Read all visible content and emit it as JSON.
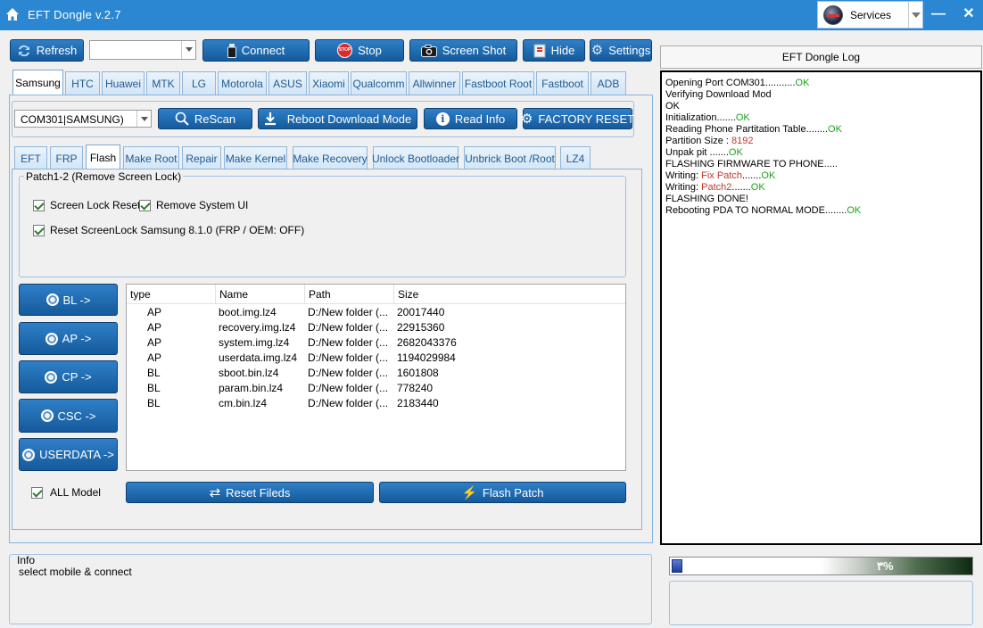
{
  "window": {
    "title": "EFT Dongle  v.2.7",
    "services_label": "Services",
    "minimize": "—",
    "close": "✕"
  },
  "toolbar": {
    "refresh": "Refresh",
    "port_value": "",
    "connect": "Connect",
    "stop": "Stop",
    "stop_badge": "STOP",
    "screenshot": "Screen Shot",
    "hide": "Hide",
    "settings": "Settings"
  },
  "brand_tabs": [
    "Samsung",
    "HTC",
    "Huawei",
    "MTK",
    "LG",
    "Motorola",
    "ASUS",
    "Xiaomi",
    "Qualcomm",
    "Allwinner",
    "Fastboot Root",
    "Fastboot",
    "ADB"
  ],
  "brand_active": "Samsung",
  "device_bar": {
    "port_select": "COM301|SAMSUNG)",
    "rescan": "ReScan",
    "reboot_download": "Reboot  Download Mode",
    "read_info": "Read Info",
    "factory_reset": "FACTORY RESET"
  },
  "func_tabs": [
    "EFT",
    "FRP",
    "Flash",
    "Make Root",
    "Repair",
    "Make Kernel",
    "Make Recovery",
    "Unlock Bootloader",
    "Unbrick Boot /Root",
    "LZ4"
  ],
  "func_active": "Flash",
  "patch_group": {
    "title": "Patch1-2 (Remove Screen Lock)",
    "options": [
      {
        "label": "Screen Lock Reset",
        "checked": true
      },
      {
        "label": "Remove System UI",
        "checked": true
      },
      {
        "label": "Reset ScreenLock Samsung 8.1.0 (FRP / OEM: OFF)",
        "checked": true
      }
    ]
  },
  "side_buttons": [
    "BL ->",
    "AP ->",
    "CP ->",
    "CSC ->",
    "USERDATA ->"
  ],
  "all_model": {
    "label": "ALL Model",
    "checked": true
  },
  "file_table": {
    "columns": [
      "type",
      "Name",
      "Path",
      "Size"
    ],
    "rows": [
      {
        "type": "AP",
        "name": "boot.img.lz4",
        "path": "D:/New folder (...",
        "size": "20017440"
      },
      {
        "type": "AP",
        "name": "recovery.img.lz4",
        "path": "D:/New folder (...",
        "size": "22915360"
      },
      {
        "type": "AP",
        "name": "system.img.lz4",
        "path": "D:/New folder (...",
        "size": "2682043376"
      },
      {
        "type": "AP",
        "name": "userdata.img.lz4",
        "path": "D:/New folder (...",
        "size": "1194029984"
      },
      {
        "type": "BL",
        "name": "sboot.bin.lz4",
        "path": "D:/New folder (...",
        "size": "1601808"
      },
      {
        "type": "BL",
        "name": "param.bin.lz4",
        "path": "D:/New folder (...",
        "size": "778240"
      },
      {
        "type": "BL",
        "name": "cm.bin.lz4",
        "path": "D:/New folder (...",
        "size": "2183440"
      }
    ]
  },
  "actions": {
    "reset_fields": "Reset Fileds",
    "flash_patch": "Flash Patch"
  },
  "log": {
    "title": "EFT Dongle Log",
    "lines": [
      [
        {
          "t": "Opening Port COM301..........."
        },
        {
          "t": "OK",
          "c": "ok"
        }
      ],
      [
        {
          "t": "Verifying Download Mod"
        }
      ],
      [
        {
          "t": "OK"
        }
      ],
      [
        {
          "t": "Initialization......."
        },
        {
          "t": "OK",
          "c": "ok"
        }
      ],
      [
        {
          "t": "Reading Phone Partitation Table........"
        },
        {
          "t": "OK",
          "c": "ok"
        }
      ],
      [
        {
          "t": "Partition Size : "
        },
        {
          "t": "8192",
          "c": "red"
        }
      ],
      [
        {
          "t": "Unpak pit ......."
        },
        {
          "t": "OK",
          "c": "ok"
        }
      ],
      [
        {
          "t": "FLASHING FIRMWARE TO PHONE....."
        }
      ],
      [
        {
          "t": "Writing: "
        },
        {
          "t": "Fix Patch",
          "c": "red"
        },
        {
          "t": "......."
        },
        {
          "t": "OK",
          "c": "ok"
        }
      ],
      [
        {
          "t": "Writing: "
        },
        {
          "t": "Patch2",
          "c": "red"
        },
        {
          "t": "......."
        },
        {
          "t": "OK",
          "c": "ok"
        }
      ],
      [
        {
          "t": "FLASHING DONE!"
        }
      ],
      [
        {
          "t": "Rebooting PDA TO NORMAL MODE........"
        },
        {
          "t": "OK",
          "c": "ok"
        }
      ]
    ]
  },
  "info": {
    "title": "Info",
    "message": "select mobile & connect"
  },
  "progress": {
    "percent": 3,
    "label": "٣%"
  },
  "colors": {
    "accent": "#2b87d1",
    "ok": "#1aa31a",
    "error": "#c0392b",
    "button": "#1e6cb3"
  }
}
